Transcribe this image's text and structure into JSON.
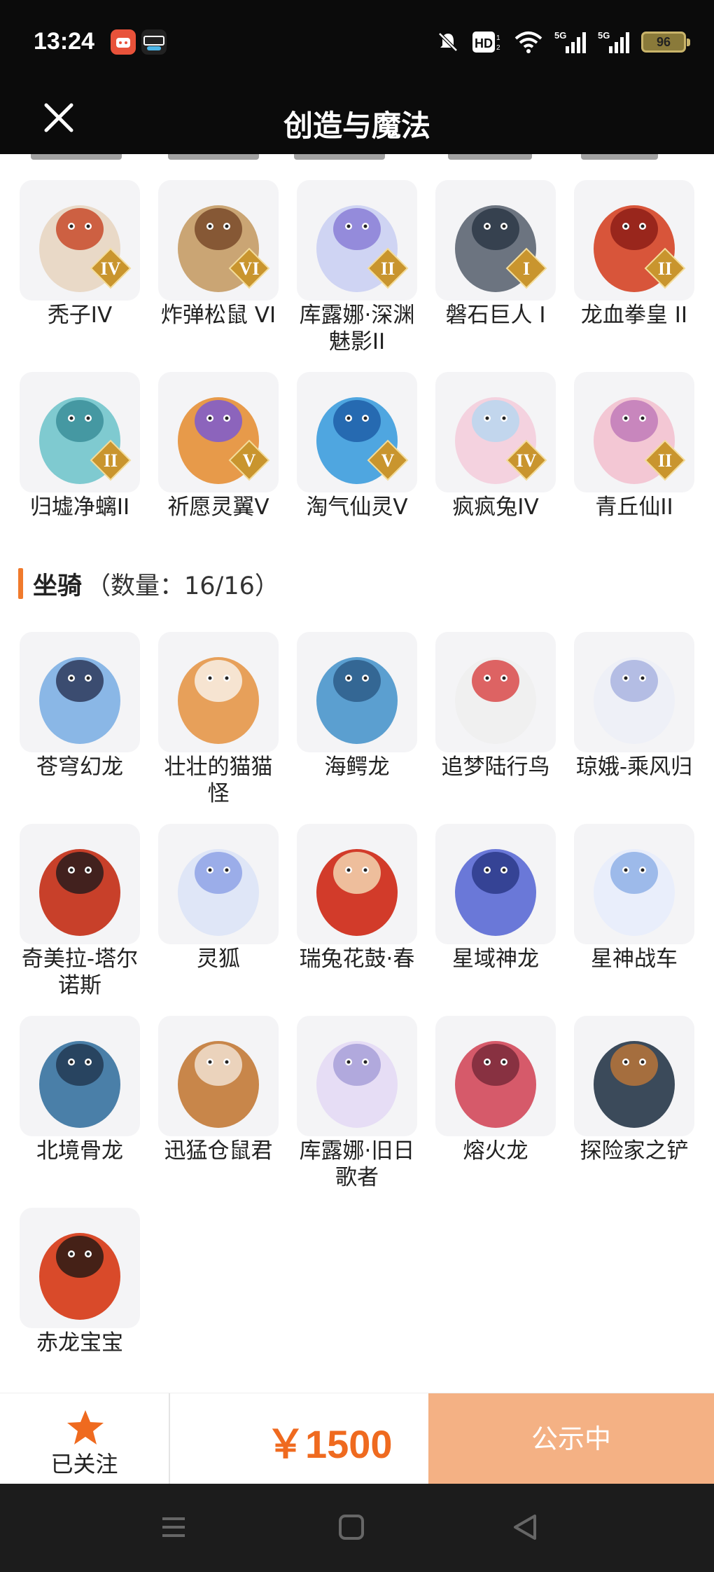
{
  "status_bar": {
    "time": "13:24",
    "battery": "96",
    "icons": [
      "app-icon-red",
      "app-icon-deyu",
      "mute-icon",
      "hd-icon",
      "wifi-icon",
      "signal-5g-icon",
      "signal-5g-icon",
      "battery-icon"
    ]
  },
  "header": {
    "title": "创造与魔法",
    "close_icon": "close-icon"
  },
  "pets_rows": [
    [
      {
        "name": "秃子IV",
        "badge": "IV"
      },
      {
        "name": "炸弹松鼠 VI",
        "badge": "VI"
      },
      {
        "name": "库露娜·深渊魅影II",
        "badge": "II"
      },
      {
        "name": "磐石巨人 I",
        "badge": "I"
      },
      {
        "name": "龙血拳皇 II",
        "badge": "II"
      }
    ],
    [
      {
        "name": "归墟净螭II",
        "badge": "II"
      },
      {
        "name": "祈愿灵翼V",
        "badge": "V"
      },
      {
        "name": "淘气仙灵V",
        "badge": "V"
      },
      {
        "name": "疯疯兔IV",
        "badge": "IV"
      },
      {
        "name": "青丘仙II",
        "badge": "II"
      }
    ]
  ],
  "mounts_section": {
    "title": "坐骑",
    "count": "（数量：16/16）"
  },
  "mounts_rows": [
    [
      {
        "name": "苍穹幻龙"
      },
      {
        "name": "壮壮的猫猫怪"
      },
      {
        "name": "海鳄龙"
      },
      {
        "name": "追梦陆行鸟"
      },
      {
        "name": "琼娥-乘风归"
      }
    ],
    [
      {
        "name": "奇美拉-塔尔诺斯"
      },
      {
        "name": "灵狐"
      },
      {
        "name": "瑞兔花鼓·春"
      },
      {
        "name": "星域神龙"
      },
      {
        "name": "星神战车"
      }
    ],
    [
      {
        "name": "北境骨龙"
      },
      {
        "name": "迅猛仓鼠君"
      },
      {
        "name": "库露娜·旧日歌者"
      },
      {
        "name": "熔火龙"
      },
      {
        "name": "探险家之铲"
      }
    ],
    [
      {
        "name": "赤龙宝宝"
      }
    ]
  ],
  "bottom_bar": {
    "follow_label": "已关注",
    "price": "￥1500",
    "status_label": "公示中"
  },
  "colors": {
    "accent": "#ef6a1f",
    "status_button": "#f4b184",
    "section_bar": "#f07a2c",
    "badge_gold": "#c9952e"
  }
}
